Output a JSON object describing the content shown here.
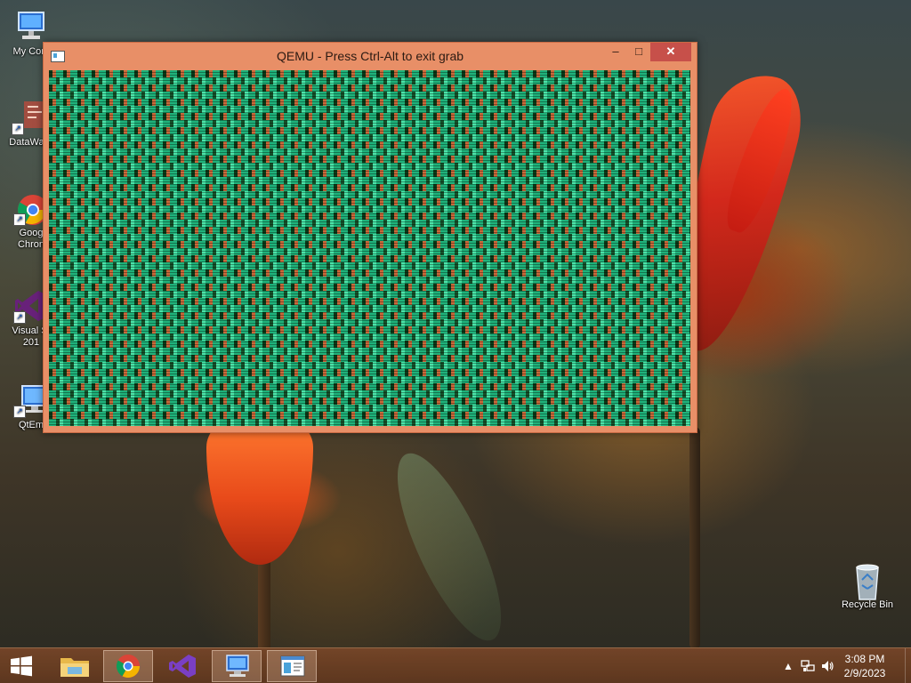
{
  "desktop_icons": [
    {
      "id": "my-computer",
      "label": "My Com"
    },
    {
      "id": "datawag",
      "label": "DataWag"
    },
    {
      "id": "chrome",
      "label_line1": "Goog",
      "label_line2": "Chron"
    },
    {
      "id": "visual-studio",
      "label_line1": "Visual St",
      "label_line2": "201"
    },
    {
      "id": "qtemu",
      "label": "QtEm"
    },
    {
      "id": "recycle-bin",
      "label": "Recycle Bin"
    }
  ],
  "qemu_window": {
    "title": "QEMU - Press Ctrl-Alt to exit grab",
    "minimize_glyph": "–",
    "maximize_glyph": "□",
    "close_glyph": "✕"
  },
  "taskbar": {
    "items": [
      "start",
      "file-explorer",
      "google-chrome",
      "visual-studio",
      "qtemu",
      "qemu"
    ],
    "tray_expand_glyph": "▲",
    "clock_time": "3:08 PM",
    "clock_date": "2/9/2023"
  },
  "colors": {
    "window_frame": "#e88f67",
    "close_button": "#c7504a",
    "taskbar": "#6e4024"
  }
}
